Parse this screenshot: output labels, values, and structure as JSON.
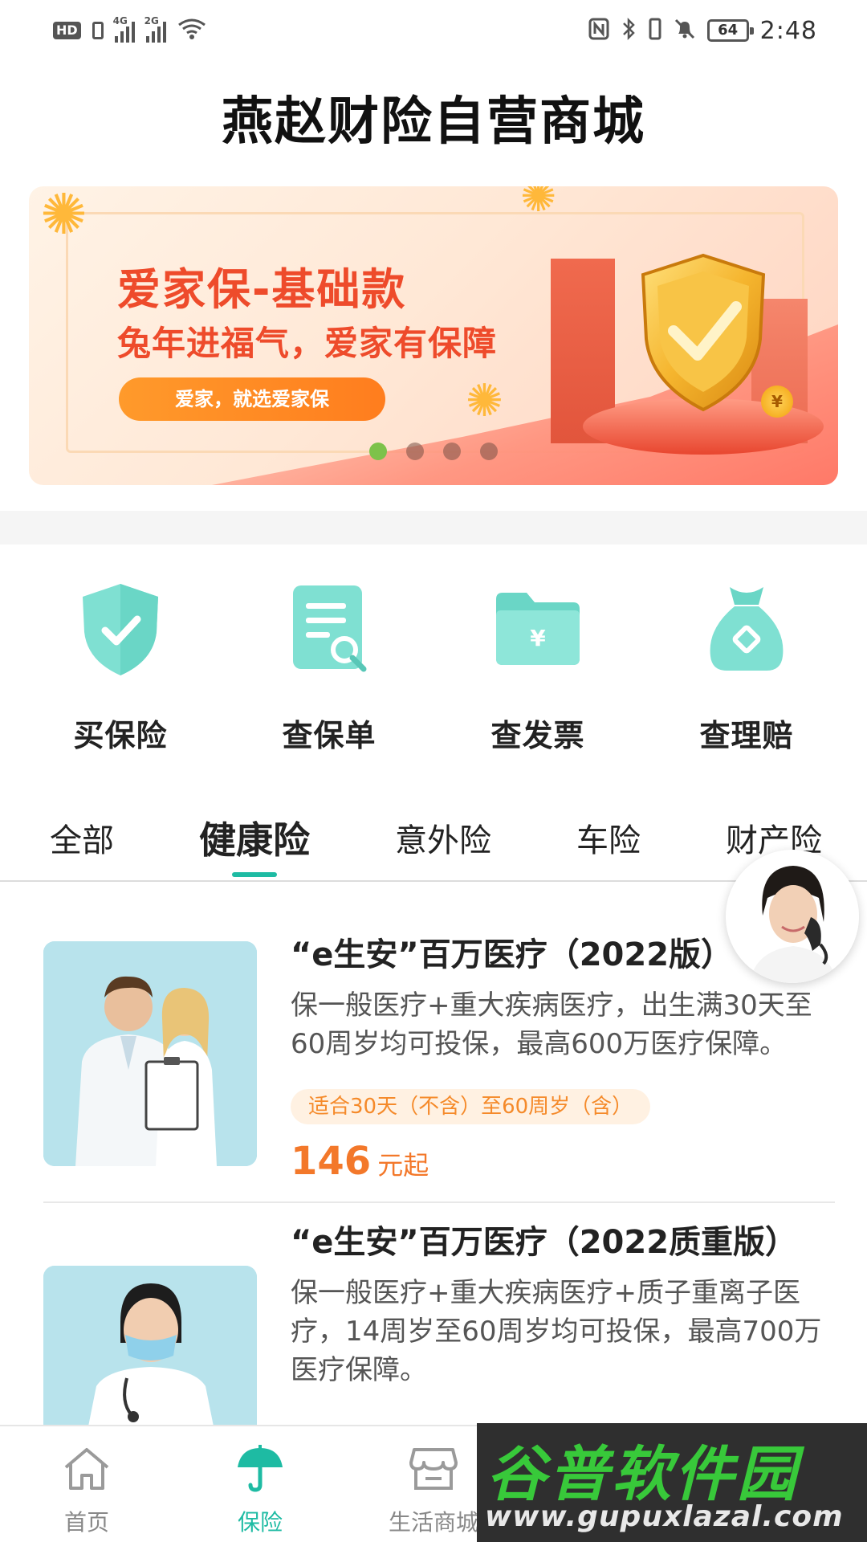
{
  "status_bar": {
    "hd": "HD",
    "sim1_label": "1",
    "signal1_label": "4G",
    "signal2_label": "2G",
    "battery": "64",
    "time": "2:48"
  },
  "header": {
    "title": "燕赵财险自营商城"
  },
  "banner": {
    "title": "爱家保-基础款",
    "subtitle": "兔年进福气，爱家有保障",
    "button_label": "爱家，就选爱家保",
    "coin_symbol": "¥",
    "slides": 4,
    "active_slide": 1
  },
  "quick_actions": [
    {
      "label": "买保险",
      "icon": "shield-check-icon"
    },
    {
      "label": "查保单",
      "icon": "document-search-icon"
    },
    {
      "label": "查发票",
      "icon": "folder-yen-icon"
    },
    {
      "label": "查理赔",
      "icon": "money-bag-icon"
    }
  ],
  "tabs": [
    {
      "label": "全部",
      "active": false
    },
    {
      "label": "健康险",
      "active": true
    },
    {
      "label": "意外险",
      "active": false
    },
    {
      "label": "车险",
      "active": false
    },
    {
      "label": "财产险",
      "active": false
    }
  ],
  "products": [
    {
      "title": "“e生安”百万医疗（2022版）",
      "description": "保一般医疗+重大疾病医疗，出生满30天至60周岁均可投保，最高600万医疗保障。",
      "tag": "适合30天（不含）至60周岁（含）",
      "price": "146",
      "price_unit": "元起"
    },
    {
      "title": "“e生安”百万医疗（2022质重版）",
      "description": "保一般医疗+重大疾病医疗+质子重离子医疗，14周岁至60周岁均可投保，最高700万医疗保障。"
    }
  ],
  "bottom_nav": [
    {
      "label": "首页",
      "icon": "home-icon",
      "active": false
    },
    {
      "label": "保险",
      "icon": "umbrella-icon",
      "active": true
    },
    {
      "label": "生活商城",
      "icon": "store-icon",
      "active": false
    }
  ],
  "watermark": {
    "brand": "谷普软件园",
    "url": "www.gupuxlazal.com"
  },
  "colors": {
    "accent": "#1ebba3",
    "price": "#f3782a",
    "banner_text": "#ee4b2b",
    "dot_active": "#7dc24a"
  }
}
